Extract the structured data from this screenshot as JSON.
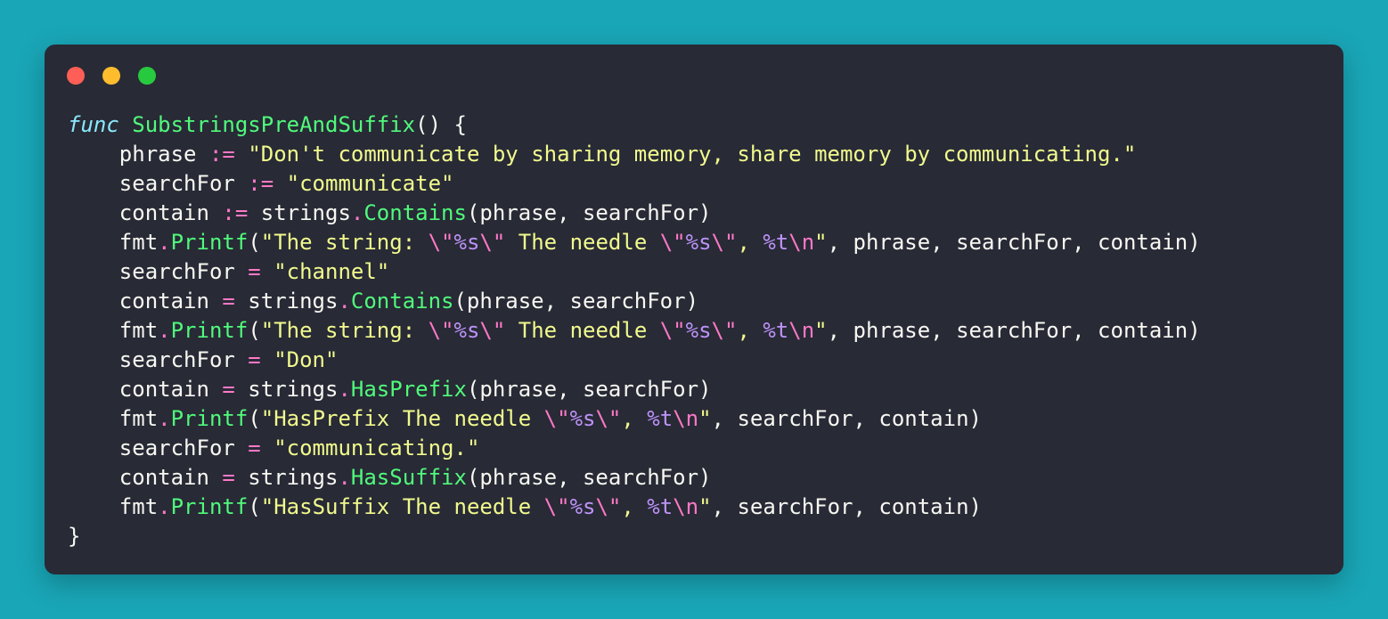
{
  "theme": {
    "page_background": "#19a6b7",
    "window_background": "#282a36",
    "colors": {
      "default": "#f8f8f2",
      "keyword": "#8be9fd",
      "func": "#50fa7b",
      "op": "#ff79c6",
      "string": "#f1fa8c",
      "format": "#bd93f9",
      "escape": "#ff79c6"
    }
  },
  "window_controls": [
    {
      "name": "close-dot",
      "color": "#ff5f56"
    },
    {
      "name": "minimize-dot",
      "color": "#ffbd2e"
    },
    {
      "name": "zoom-dot",
      "color": "#27c93f"
    }
  ],
  "code": {
    "language": "go",
    "lines": [
      [
        [
          "keyword",
          "func"
        ],
        [
          "default",
          " "
        ],
        [
          "func",
          "SubstringsPreAndSuffix"
        ],
        [
          "default",
          "() {"
        ]
      ],
      [
        [
          "default",
          "    phrase "
        ],
        [
          "op",
          ":="
        ],
        [
          "default",
          " "
        ],
        [
          "string",
          "\"Don't communicate by sharing memory, share memory by communicating.\""
        ]
      ],
      [
        [
          "default",
          "    searchFor "
        ],
        [
          "op",
          ":="
        ],
        [
          "default",
          " "
        ],
        [
          "string",
          "\"communicate\""
        ]
      ],
      [
        [
          "default",
          "    contain "
        ],
        [
          "op",
          ":="
        ],
        [
          "default",
          " strings"
        ],
        [
          "op",
          "."
        ],
        [
          "func",
          "Contains"
        ],
        [
          "default",
          "(phrase, searchFor)"
        ]
      ],
      [
        [
          "default",
          "    fmt"
        ],
        [
          "op",
          "."
        ],
        [
          "func",
          "Printf"
        ],
        [
          "default",
          "("
        ],
        [
          "string",
          "\"The string: "
        ],
        [
          "escape",
          "\\\""
        ],
        [
          "format",
          "%s"
        ],
        [
          "escape",
          "\\\""
        ],
        [
          "string",
          " The needle "
        ],
        [
          "escape",
          "\\\""
        ],
        [
          "format",
          "%s"
        ],
        [
          "escape",
          "\\\""
        ],
        [
          "string",
          ", "
        ],
        [
          "format",
          "%t"
        ],
        [
          "escape",
          "\\n"
        ],
        [
          "string",
          "\""
        ],
        [
          "default",
          ", phrase, searchFor, contain)"
        ]
      ],
      [
        [
          "default",
          "    searchFor "
        ],
        [
          "op",
          "="
        ],
        [
          "default",
          " "
        ],
        [
          "string",
          "\"channel\""
        ]
      ],
      [
        [
          "default",
          "    contain "
        ],
        [
          "op",
          "="
        ],
        [
          "default",
          " strings"
        ],
        [
          "op",
          "."
        ],
        [
          "func",
          "Contains"
        ],
        [
          "default",
          "(phrase, searchFor)"
        ]
      ],
      [
        [
          "default",
          "    fmt"
        ],
        [
          "op",
          "."
        ],
        [
          "func",
          "Printf"
        ],
        [
          "default",
          "("
        ],
        [
          "string",
          "\"The string: "
        ],
        [
          "escape",
          "\\\""
        ],
        [
          "format",
          "%s"
        ],
        [
          "escape",
          "\\\""
        ],
        [
          "string",
          " The needle "
        ],
        [
          "escape",
          "\\\""
        ],
        [
          "format",
          "%s"
        ],
        [
          "escape",
          "\\\""
        ],
        [
          "string",
          ", "
        ],
        [
          "format",
          "%t"
        ],
        [
          "escape",
          "\\n"
        ],
        [
          "string",
          "\""
        ],
        [
          "default",
          ", phrase, searchFor, contain)"
        ]
      ],
      [
        [
          "default",
          "    searchFor "
        ],
        [
          "op",
          "="
        ],
        [
          "default",
          " "
        ],
        [
          "string",
          "\"Don\""
        ]
      ],
      [
        [
          "default",
          "    contain "
        ],
        [
          "op",
          "="
        ],
        [
          "default",
          " strings"
        ],
        [
          "op",
          "."
        ],
        [
          "func",
          "HasPrefix"
        ],
        [
          "default",
          "(phrase, searchFor)"
        ]
      ],
      [
        [
          "default",
          "    fmt"
        ],
        [
          "op",
          "."
        ],
        [
          "func",
          "Printf"
        ],
        [
          "default",
          "("
        ],
        [
          "string",
          "\"HasPrefix The needle "
        ],
        [
          "escape",
          "\\\""
        ],
        [
          "format",
          "%s"
        ],
        [
          "escape",
          "\\\""
        ],
        [
          "string",
          ", "
        ],
        [
          "format",
          "%t"
        ],
        [
          "escape",
          "\\n"
        ],
        [
          "string",
          "\""
        ],
        [
          "default",
          ", searchFor, contain)"
        ]
      ],
      [
        [
          "default",
          "    searchFor "
        ],
        [
          "op",
          "="
        ],
        [
          "default",
          " "
        ],
        [
          "string",
          "\"communicating.\""
        ]
      ],
      [
        [
          "default",
          "    contain "
        ],
        [
          "op",
          "="
        ],
        [
          "default",
          " strings"
        ],
        [
          "op",
          "."
        ],
        [
          "func",
          "HasSuffix"
        ],
        [
          "default",
          "(phrase, searchFor)"
        ]
      ],
      [
        [
          "default",
          "    fmt"
        ],
        [
          "op",
          "."
        ],
        [
          "func",
          "Printf"
        ],
        [
          "default",
          "("
        ],
        [
          "string",
          "\"HasSuffix The needle "
        ],
        [
          "escape",
          "\\\""
        ],
        [
          "format",
          "%s"
        ],
        [
          "escape",
          "\\\""
        ],
        [
          "string",
          ", "
        ],
        [
          "format",
          "%t"
        ],
        [
          "escape",
          "\\n"
        ],
        [
          "string",
          "\""
        ],
        [
          "default",
          ", searchFor, contain)"
        ]
      ],
      [
        [
          "default",
          "}"
        ]
      ]
    ]
  }
}
